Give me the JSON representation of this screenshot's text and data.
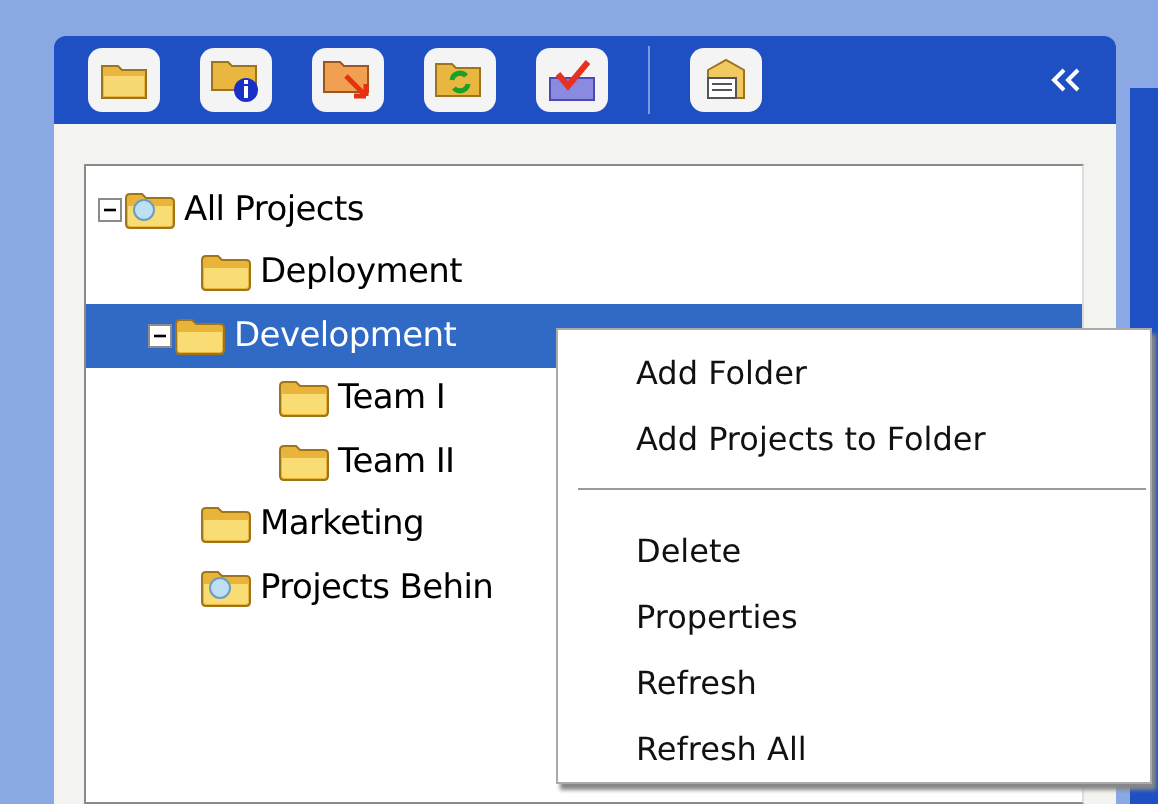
{
  "tree": [
    {
      "label": "All Projects",
      "kind": "special-folder",
      "expanded": true,
      "selected": false,
      "children": [
        {
          "label": "Deployment",
          "kind": "folder",
          "selected": false
        },
        {
          "label": "Development",
          "kind": "folder",
          "expanded": true,
          "selected": true,
          "children": [
            {
              "label": "Team I",
              "kind": "folder",
              "selected": false
            },
            {
              "label": "Team II",
              "kind": "folder",
              "selected": false
            }
          ]
        },
        {
          "label": "Marketing",
          "kind": "folder",
          "selected": false
        },
        {
          "label": "Projects Behin",
          "kind": "special-folder",
          "selected": false
        }
      ]
    }
  ],
  "context_menu": [
    {
      "kind": "item",
      "label": "Add Folder"
    },
    {
      "kind": "item",
      "label": "Add Projects to Folder"
    },
    {
      "kind": "separator"
    },
    {
      "kind": "item",
      "label": "Delete"
    },
    {
      "kind": "item",
      "label": "Properties"
    },
    {
      "kind": "item",
      "label": "Refresh"
    },
    {
      "kind": "item",
      "label": "Refresh All"
    }
  ]
}
